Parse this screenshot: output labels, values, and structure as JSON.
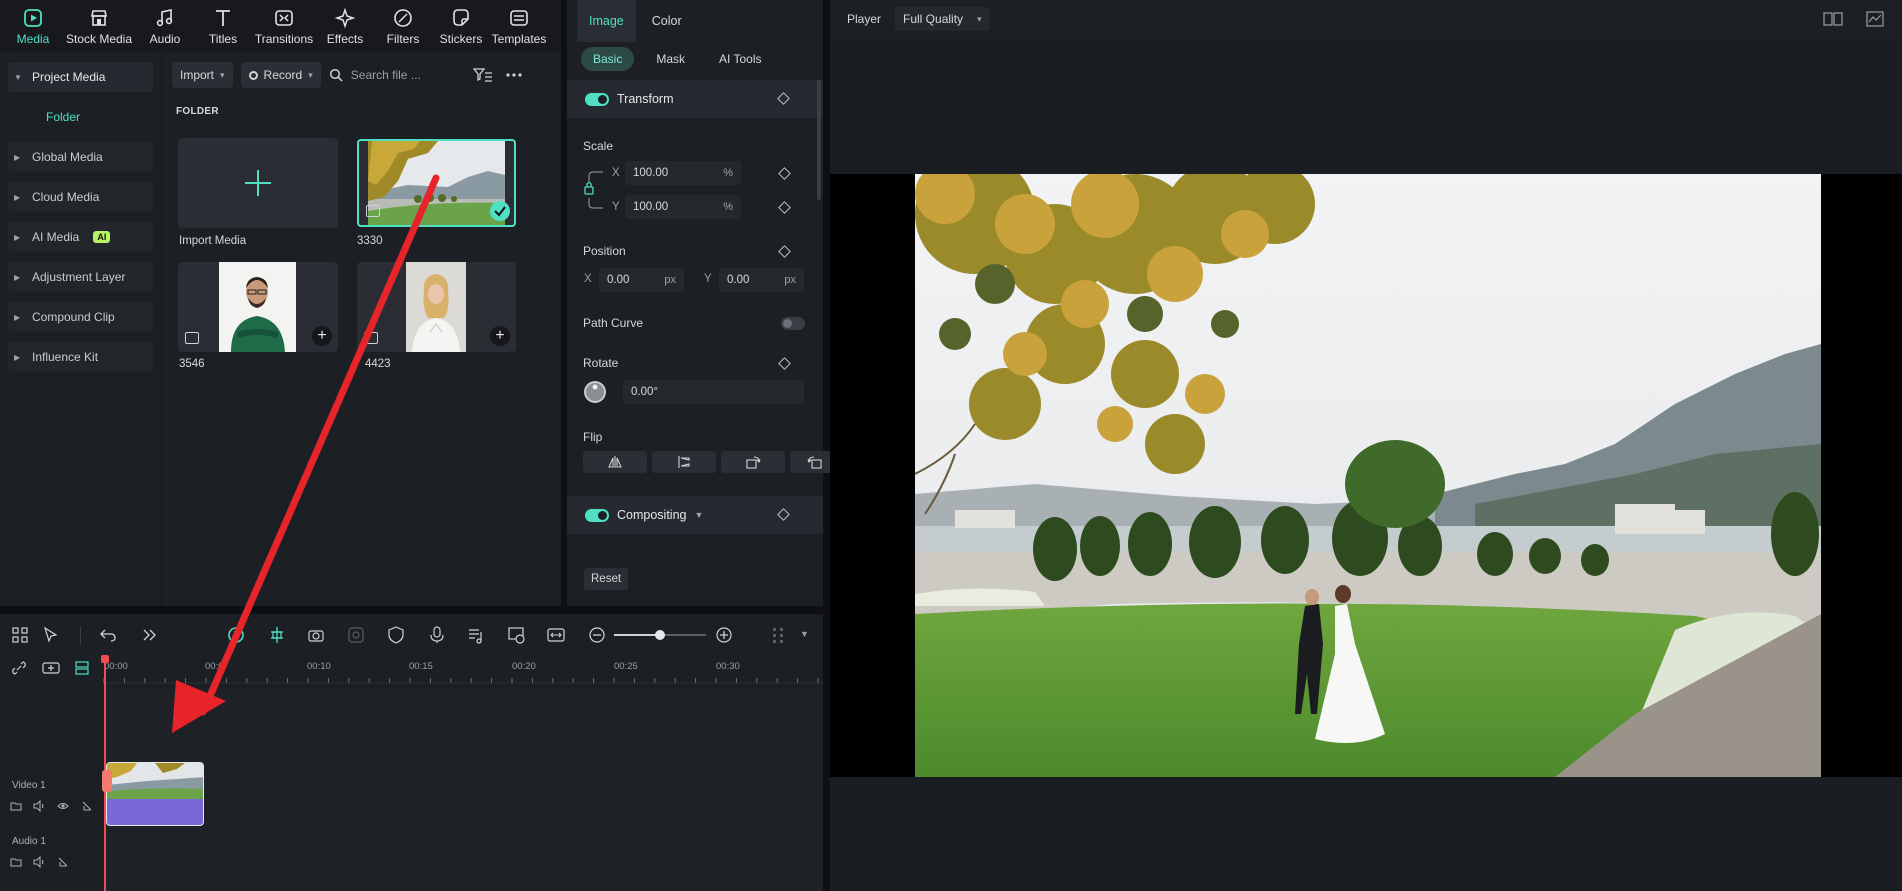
{
  "top_tabs": [
    {
      "label": "Media",
      "icon": "media-icon",
      "active": true
    },
    {
      "label": "Stock Media",
      "icon": "stock-media-icon"
    },
    {
      "label": "Audio",
      "icon": "audio-icon"
    },
    {
      "label": "Titles",
      "icon": "titles-icon"
    },
    {
      "label": "Transitions",
      "icon": "transitions-icon"
    },
    {
      "label": "Effects",
      "icon": "effects-icon"
    },
    {
      "label": "Filters",
      "icon": "filters-icon"
    },
    {
      "label": "Stickers",
      "icon": "stickers-icon"
    },
    {
      "label": "Templates",
      "icon": "templates-icon"
    }
  ],
  "sidebar": {
    "items": [
      {
        "label": "Project Media",
        "open": true
      },
      {
        "label": "Folder",
        "sub": true
      },
      {
        "label": "Global Media"
      },
      {
        "label": "Cloud Media"
      },
      {
        "label": "AI Media",
        "badge": "AI"
      },
      {
        "label": "Adjustment Layer"
      },
      {
        "label": "Compound Clip"
      },
      {
        "label": "Influence Kit"
      }
    ]
  },
  "media_toolbar": {
    "import_label": "Import",
    "record_label": "Record",
    "search_placeholder": "Search file ..."
  },
  "folder_label": "FOLDER",
  "media_items": [
    {
      "label": "Import Media"
    },
    {
      "label": "3330",
      "selected": true
    },
    {
      "label": "3546"
    },
    {
      "label": "4423"
    }
  ],
  "property": {
    "tabs": [
      "Image",
      "Color"
    ],
    "subtabs": [
      "Basic",
      "Mask",
      "AI Tools"
    ],
    "transform_label": "Transform",
    "scale_label": "Scale",
    "scale_x": "100.00",
    "scale_y": "100.00",
    "percent": "%",
    "x_axis": "X",
    "y_axis": "Y",
    "position_label": "Position",
    "pos_x": "0.00",
    "pos_y": "0.00",
    "px": "px",
    "path_curve_label": "Path Curve",
    "rotate_label": "Rotate",
    "rotate_value": "0.00°",
    "flip_label": "Flip",
    "compositing_label": "Compositing",
    "reset_label": "Reset"
  },
  "player": {
    "label": "Player",
    "quality": "Full Quality"
  },
  "timeline": {
    "ticks": [
      "00:00",
      "00:00:05",
      "00:00:10",
      "00:00:15",
      "00:00:20",
      "00:00:25",
      "00:00:30"
    ],
    "ticks_shown": [
      "00:00",
      "00:0",
      "00:10",
      "00:15",
      "00:20",
      "00:25",
      "00:30"
    ],
    "video_track": "Video 1",
    "audio_track": "Audio 1"
  },
  "colors": {
    "accent": "#4fe0c4",
    "playhead": "#f04c52",
    "clip": "#7b68d8",
    "arrow": "#e8242b"
  }
}
